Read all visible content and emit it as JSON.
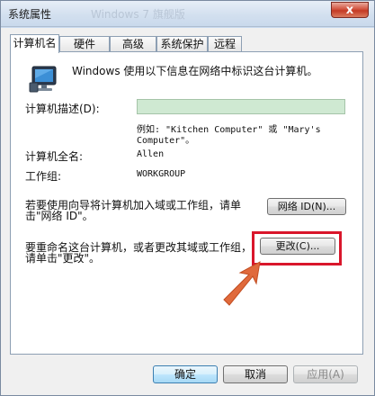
{
  "window": {
    "title": "系统属性",
    "faded_title": "Windows 7 旗舰版",
    "close_label": "x"
  },
  "tabs": [
    {
      "label": "计算机名",
      "active": true
    },
    {
      "label": "硬件",
      "active": false
    },
    {
      "label": "高级",
      "active": false
    },
    {
      "label": "系统保护",
      "active": false
    },
    {
      "label": "远程",
      "active": false
    }
  ],
  "intro_text": "Windows 使用以下信息在网络中标识这台计算机。",
  "fields": {
    "description_label": "计算机描述(D):",
    "description_value": "",
    "example_line1": "例如: \"Kitchen Computer\" 或 \"Mary's",
    "example_line2": "Computer\"。",
    "fullname_label": "计算机全名:",
    "fullname_value": "Allen",
    "workgroup_label": "工作组:",
    "workgroup_value": "WORKGROUP"
  },
  "network_id": {
    "text_line1": "若要使用向导将计算机加入域或工作组，请单",
    "text_line2": "击\"网络 ID\"。",
    "button_label": "网络 ID(N)..."
  },
  "rename": {
    "text_line1": "要重命名这台计算机，或者更改其域或工作组，",
    "text_line2": "请单击\"更改\"。",
    "button_label": "更改(C)..."
  },
  "footer": {
    "ok_label": "确定",
    "cancel_label": "取消",
    "apply_label": "应用(A)"
  },
  "colors": {
    "highlight": "#d9162b",
    "arrow": "#e06a3c"
  }
}
